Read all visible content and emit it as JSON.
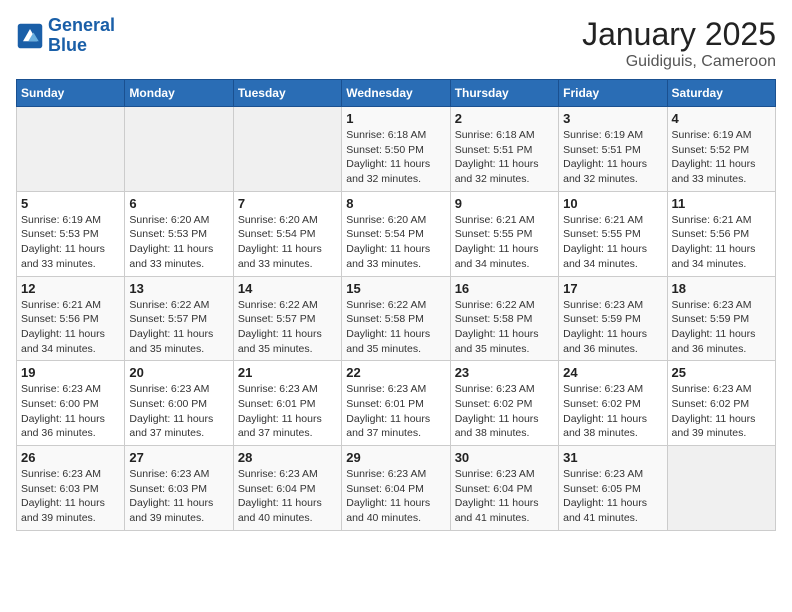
{
  "header": {
    "logo_line1": "General",
    "logo_line2": "Blue",
    "title": "January 2025",
    "subtitle": "Guidiguis, Cameroon"
  },
  "weekdays": [
    "Sunday",
    "Monday",
    "Tuesday",
    "Wednesday",
    "Thursday",
    "Friday",
    "Saturday"
  ],
  "weeks": [
    [
      {
        "day": "",
        "info": ""
      },
      {
        "day": "",
        "info": ""
      },
      {
        "day": "",
        "info": ""
      },
      {
        "day": "1",
        "info": "Sunrise: 6:18 AM\nSunset: 5:50 PM\nDaylight: 11 hours\nand 32 minutes."
      },
      {
        "day": "2",
        "info": "Sunrise: 6:18 AM\nSunset: 5:51 PM\nDaylight: 11 hours\nand 32 minutes."
      },
      {
        "day": "3",
        "info": "Sunrise: 6:19 AM\nSunset: 5:51 PM\nDaylight: 11 hours\nand 32 minutes."
      },
      {
        "day": "4",
        "info": "Sunrise: 6:19 AM\nSunset: 5:52 PM\nDaylight: 11 hours\nand 33 minutes."
      }
    ],
    [
      {
        "day": "5",
        "info": "Sunrise: 6:19 AM\nSunset: 5:53 PM\nDaylight: 11 hours\nand 33 minutes."
      },
      {
        "day": "6",
        "info": "Sunrise: 6:20 AM\nSunset: 5:53 PM\nDaylight: 11 hours\nand 33 minutes."
      },
      {
        "day": "7",
        "info": "Sunrise: 6:20 AM\nSunset: 5:54 PM\nDaylight: 11 hours\nand 33 minutes."
      },
      {
        "day": "8",
        "info": "Sunrise: 6:20 AM\nSunset: 5:54 PM\nDaylight: 11 hours\nand 33 minutes."
      },
      {
        "day": "9",
        "info": "Sunrise: 6:21 AM\nSunset: 5:55 PM\nDaylight: 11 hours\nand 34 minutes."
      },
      {
        "day": "10",
        "info": "Sunrise: 6:21 AM\nSunset: 5:55 PM\nDaylight: 11 hours\nand 34 minutes."
      },
      {
        "day": "11",
        "info": "Sunrise: 6:21 AM\nSunset: 5:56 PM\nDaylight: 11 hours\nand 34 minutes."
      }
    ],
    [
      {
        "day": "12",
        "info": "Sunrise: 6:21 AM\nSunset: 5:56 PM\nDaylight: 11 hours\nand 34 minutes."
      },
      {
        "day": "13",
        "info": "Sunrise: 6:22 AM\nSunset: 5:57 PM\nDaylight: 11 hours\nand 35 minutes."
      },
      {
        "day": "14",
        "info": "Sunrise: 6:22 AM\nSunset: 5:57 PM\nDaylight: 11 hours\nand 35 minutes."
      },
      {
        "day": "15",
        "info": "Sunrise: 6:22 AM\nSunset: 5:58 PM\nDaylight: 11 hours\nand 35 minutes."
      },
      {
        "day": "16",
        "info": "Sunrise: 6:22 AM\nSunset: 5:58 PM\nDaylight: 11 hours\nand 35 minutes."
      },
      {
        "day": "17",
        "info": "Sunrise: 6:23 AM\nSunset: 5:59 PM\nDaylight: 11 hours\nand 36 minutes."
      },
      {
        "day": "18",
        "info": "Sunrise: 6:23 AM\nSunset: 5:59 PM\nDaylight: 11 hours\nand 36 minutes."
      }
    ],
    [
      {
        "day": "19",
        "info": "Sunrise: 6:23 AM\nSunset: 6:00 PM\nDaylight: 11 hours\nand 36 minutes."
      },
      {
        "day": "20",
        "info": "Sunrise: 6:23 AM\nSunset: 6:00 PM\nDaylight: 11 hours\nand 37 minutes."
      },
      {
        "day": "21",
        "info": "Sunrise: 6:23 AM\nSunset: 6:01 PM\nDaylight: 11 hours\nand 37 minutes."
      },
      {
        "day": "22",
        "info": "Sunrise: 6:23 AM\nSunset: 6:01 PM\nDaylight: 11 hours\nand 37 minutes."
      },
      {
        "day": "23",
        "info": "Sunrise: 6:23 AM\nSunset: 6:02 PM\nDaylight: 11 hours\nand 38 minutes."
      },
      {
        "day": "24",
        "info": "Sunrise: 6:23 AM\nSunset: 6:02 PM\nDaylight: 11 hours\nand 38 minutes."
      },
      {
        "day": "25",
        "info": "Sunrise: 6:23 AM\nSunset: 6:02 PM\nDaylight: 11 hours\nand 39 minutes."
      }
    ],
    [
      {
        "day": "26",
        "info": "Sunrise: 6:23 AM\nSunset: 6:03 PM\nDaylight: 11 hours\nand 39 minutes."
      },
      {
        "day": "27",
        "info": "Sunrise: 6:23 AM\nSunset: 6:03 PM\nDaylight: 11 hours\nand 39 minutes."
      },
      {
        "day": "28",
        "info": "Sunrise: 6:23 AM\nSunset: 6:04 PM\nDaylight: 11 hours\nand 40 minutes."
      },
      {
        "day": "29",
        "info": "Sunrise: 6:23 AM\nSunset: 6:04 PM\nDaylight: 11 hours\nand 40 minutes."
      },
      {
        "day": "30",
        "info": "Sunrise: 6:23 AM\nSunset: 6:04 PM\nDaylight: 11 hours\nand 41 minutes."
      },
      {
        "day": "31",
        "info": "Sunrise: 6:23 AM\nSunset: 6:05 PM\nDaylight: 11 hours\nand 41 minutes."
      },
      {
        "day": "",
        "info": ""
      }
    ]
  ]
}
